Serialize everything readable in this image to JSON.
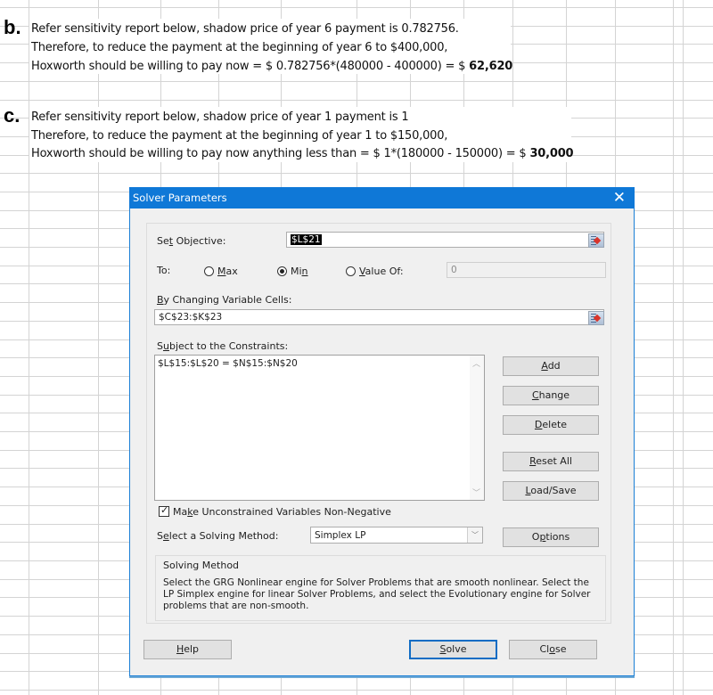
{
  "sheet": {
    "part_b": {
      "label": "b.",
      "line1": "Refer sensitivity report below, shadow price of year 6 payment is 0.782756.",
      "line2": "Therefore, to reduce the payment at the beginning of year 6 to $400,000,",
      "line3_prefix": "Hoxworth should be willing to pay now  = $ 0.782756*(480000 - 400000) = $ ",
      "line3_result": "62,620"
    },
    "part_c": {
      "label": "c.",
      "line1": "Refer sensitivity report below, shadow price of year 1 payment is 1",
      "line2": "Therefore, to reduce the payment at the beginning of year 1 to $150,000,",
      "line3_prefix": "Hoxworth should be willing to pay now anything less than = $ 1*(180000 - 150000) = $ ",
      "line3_result": "30,000"
    }
  },
  "dialog": {
    "title": "Solver Parameters",
    "close_icon": "close-icon",
    "set_objective_label": "Set Objective:",
    "set_objective_value": "$L$21",
    "to_label": "To:",
    "options": [
      {
        "label": "Max",
        "selected": false
      },
      {
        "label": "Min",
        "selected": true
      },
      {
        "label": "Value Of:",
        "selected": false
      }
    ],
    "value_of": "0",
    "changing_cells_label": "By Changing Variable Cells:",
    "changing_cells_value": "$C$23:$K$23",
    "constraints_label": "Subject to the Constraints:",
    "constraints": [
      "$L$15:$L$20 = $N$15:$N$20"
    ],
    "buttons_side": {
      "add": "Add",
      "change": "Change",
      "delete": "Delete",
      "reset_all": "Reset All",
      "load_save": "Load/Save",
      "options": "Options"
    },
    "nonneg_label": "Make Unconstrained Variables Non-Negative",
    "nonneg_checked": true,
    "solving_method_label": "Select a Solving Method:",
    "solving_method_value": "Simplex LP",
    "solving_group_title": "Solving Method",
    "solving_group_desc": "Select the GRG Nonlinear engine for Solver Problems that are smooth nonlinear. Select the LP Simplex engine for linear Solver Problems, and select the Evolutionary engine for Solver problems that are non-smooth.",
    "footer": {
      "help": "Help",
      "solve": "Solve",
      "close": "Close"
    },
    "accent_color": "#0f78d7"
  }
}
